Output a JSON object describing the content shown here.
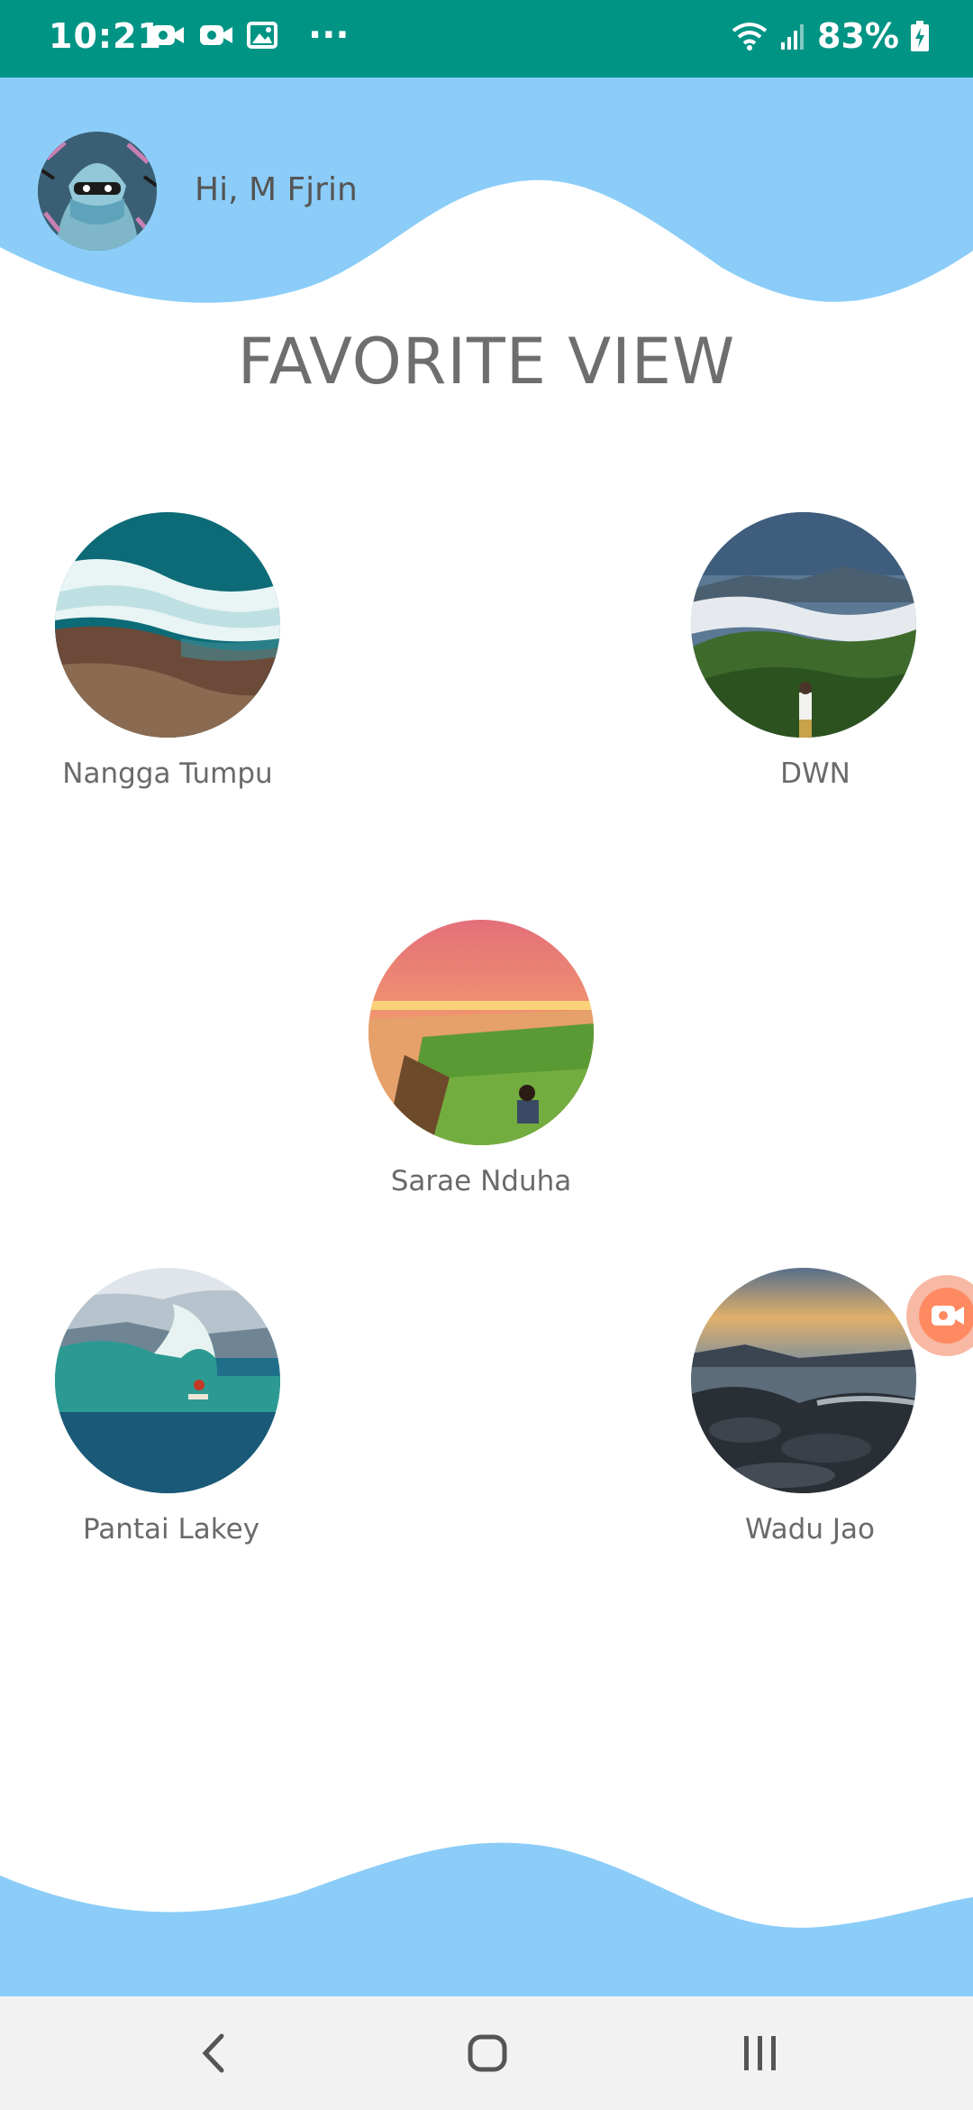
{
  "status_bar": {
    "time": "10:21",
    "battery": "83%",
    "left_icons": [
      "video-call-icon",
      "video-call-icon",
      "image-icon",
      "more-dots-icon"
    ],
    "right_icons": [
      "wifi-icon",
      "signal-icon",
      "battery-charging-icon"
    ]
  },
  "header": {
    "greeting": "Hi, M Fjrin",
    "wave_color": "#8BCDF8"
  },
  "page": {
    "title": "FAVORITE VIEW"
  },
  "places": [
    {
      "name": "Nangga Tumpu",
      "scene": "aerial coastline with waves"
    },
    {
      "name": "DWN",
      "scene": "mountain above the clouds"
    },
    {
      "name": "Sarae Nduha",
      "scene": "sunset over green cliffs"
    },
    {
      "name": "Pantai Lakey",
      "scene": "surfer on a big wave"
    },
    {
      "name": "Wadu Jao",
      "scene": "rocky shore at dusk"
    }
  ],
  "nav": {
    "buttons": [
      "back-icon",
      "home-icon",
      "recent-apps-icon"
    ]
  },
  "colors": {
    "status_bar": "#009485",
    "wave": "#8BCDF8",
    "title_text": "#6E6E6E",
    "fab": "#FF8A62"
  }
}
